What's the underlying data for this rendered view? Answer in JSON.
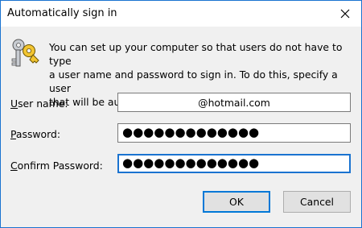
{
  "window": {
    "title": "Automatically sign in"
  },
  "icons": {
    "close": "close-icon",
    "keys": "keys-icon"
  },
  "description": {
    "line1": "You can set up your computer so that users do not have to type",
    "line2": "a user name and password to sign in. To do this, specify a user",
    "line3": "that will be automatically signed in below:"
  },
  "form": {
    "username_label_mnemonic": "U",
    "username_label_rest": "ser name:",
    "username_value": "@hotmail.com",
    "password_label_mnemonic": "P",
    "password_label_rest": "assword:",
    "password_value": "●●●●●●●●●●●●●",
    "confirm_label_mnemonic": "C",
    "confirm_label_rest": "onfirm Password:",
    "confirm_value": "●●●●●●●●●●●●●"
  },
  "buttons": {
    "ok": "OK",
    "cancel": "Cancel"
  },
  "colors": {
    "accent": "#0078d7",
    "border_active": "#1a73d0",
    "background": "#f0f0f0"
  }
}
